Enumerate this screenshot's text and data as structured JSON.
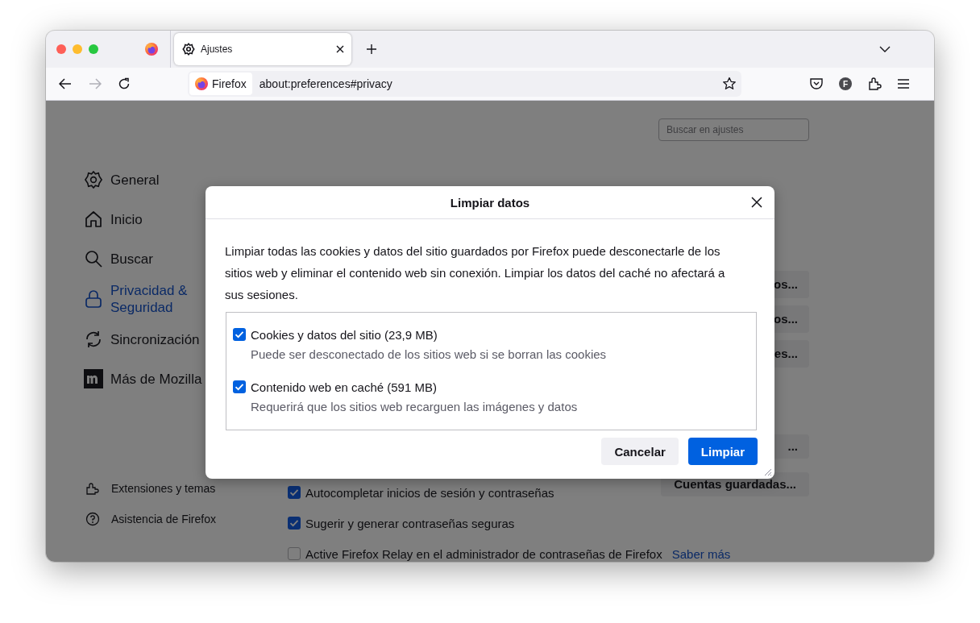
{
  "window": {
    "tabs": [
      {
        "title": "Ajustes",
        "selected": true
      }
    ],
    "navigation": {
      "back_disabled": false,
      "forward_disabled": true
    },
    "url_bar": {
      "identity": "Firefox",
      "url": "about:preferences#privacy"
    },
    "account_initial": "F"
  },
  "settings": {
    "search": {
      "placeholder": "Buscar en ajustes"
    },
    "sidebar": {
      "items": [
        {
          "label": "General",
          "selected": false
        },
        {
          "label": "Inicio",
          "selected": false
        },
        {
          "label": "Buscar",
          "selected": false
        },
        {
          "label": "Privacidad & Seguridad",
          "selected": true
        },
        {
          "label": "Sincronización",
          "selected": false
        },
        {
          "label": "Más de Mozilla",
          "selected": false
        }
      ],
      "footer": [
        {
          "label": "Extensiones y temas"
        },
        {
          "label": "Asistencia de Firefox"
        }
      ]
    },
    "obscured_buttons": [
      {
        "label": "os..."
      },
      {
        "label": "os..."
      },
      {
        "label": "es..."
      }
    ],
    "obscured_button_2": {
      "label": "..."
    },
    "saved_logins_button": {
      "label": "Cuentas guardadas..."
    },
    "checkboxes": [
      {
        "label": "Autocompletar inicios de sesión y contraseñas",
        "checked": true
      },
      {
        "label": "Sugerir y generar contraseñas seguras",
        "checked": true
      },
      {
        "label": "Active Firefox Relay en el administrador de contraseñas de Firefox",
        "checked": false,
        "link": "Saber más"
      }
    ]
  },
  "dialog": {
    "title": "Limpiar datos",
    "description": "Limpiar todas las cookies y datos del sitio guardados por Firefox puede desconectarle de los sitios web y eliminar el contenido web sin conexión. Limpiar los datos del caché no afectará a sus sesiones.",
    "options": [
      {
        "label": "Cookies y datos del sitio (23,9 MB)",
        "detail": "Puede ser desconectado de los sitios web si se borran las cookies",
        "checked": true
      },
      {
        "label": "Contenido web en caché (591 MB)",
        "detail": "Requerirá que los sitios web recarguen las imágenes y datos",
        "checked": true
      }
    ],
    "buttons": [
      {
        "label": "Cancelar",
        "kind": "secondary"
      },
      {
        "label": "Limpiar",
        "kind": "primary"
      }
    ]
  }
}
